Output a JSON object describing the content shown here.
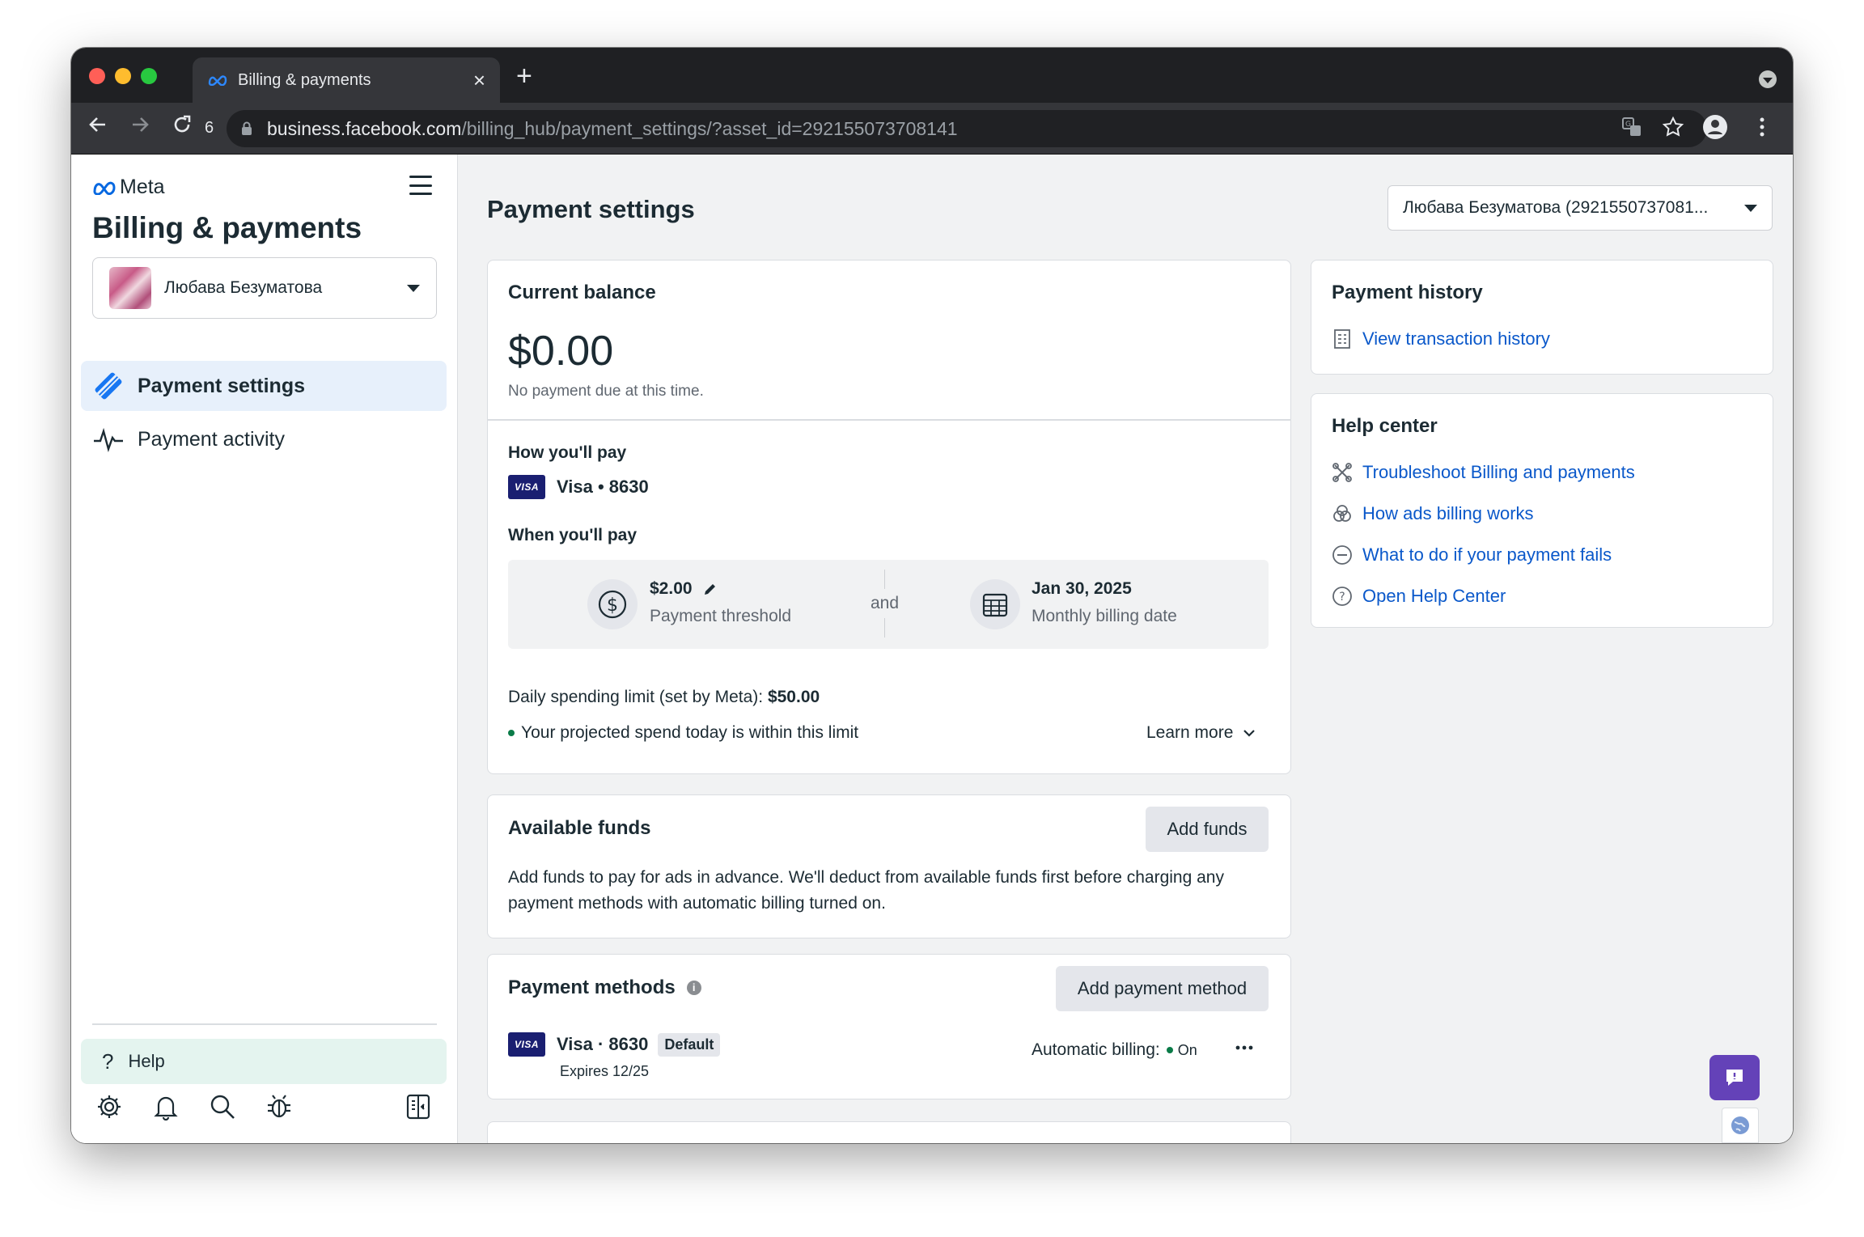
{
  "browser": {
    "tab_title": "Billing & payments",
    "reload_count": "6",
    "url_host": "business.facebook.com",
    "url_path": "/billing_hub/payment_settings/?asset_id=292155073708141"
  },
  "sidebar": {
    "logo_text": "Meta",
    "app_title": "Billing & payments",
    "account_name": "Любава Безуматова",
    "nav": [
      {
        "label": "Payment settings"
      },
      {
        "label": "Payment activity"
      }
    ],
    "help_label": "Help"
  },
  "main": {
    "title": "Payment settings",
    "account_select": "Любава Безуматова (2921550737081..."
  },
  "balance": {
    "heading": "Current balance",
    "amount": "$0.00",
    "note": "No payment due at this time.",
    "how_heading": "How you'll pay",
    "card_brand": "VISA",
    "card_label": "Visa • 8630",
    "when_heading": "When you'll pay",
    "threshold_amount": "$2.00",
    "threshold_label": "Payment threshold",
    "and_text": "and",
    "billing_date": "Jan 30, 2025",
    "billing_date_label": "Monthly billing date",
    "daily_limit_prefix": "Daily spending limit (set by Meta): ",
    "daily_limit_value": "$50.00",
    "projected_text": "Your projected spend today is within this limit",
    "learn_more": "Learn more"
  },
  "funds": {
    "heading": "Available funds",
    "button": "Add funds",
    "description": "Add funds to pay for ads in advance. We'll deduct from available funds first before charging any payment methods with automatic billing turned on."
  },
  "methods": {
    "heading": "Payment methods",
    "button": "Add payment method",
    "card_brand": "VISA",
    "card_label": "Visa · 8630",
    "default_badge": "Default",
    "expires": "Expires 12/25",
    "auto_billing_label": "Automatic billing:",
    "auto_billing_status": "On"
  },
  "history": {
    "heading": "Payment history",
    "link": "View transaction history"
  },
  "help_center": {
    "heading": "Help center",
    "links": [
      {
        "label": "Troubleshoot Billing and payments",
        "icon": "tools-icon"
      },
      {
        "label": "How ads billing works",
        "icon": "circles-icon"
      },
      {
        "label": "What to do if your payment fails",
        "icon": "minus-circle-icon"
      },
      {
        "label": "Open Help Center",
        "icon": "question-circle-icon"
      }
    ]
  },
  "colors": {
    "accent_link": "#0a58ca",
    "active_nav_bg": "#e7f0fb",
    "status_green": "#0a7b48",
    "chat_purple": "#6442b8"
  }
}
